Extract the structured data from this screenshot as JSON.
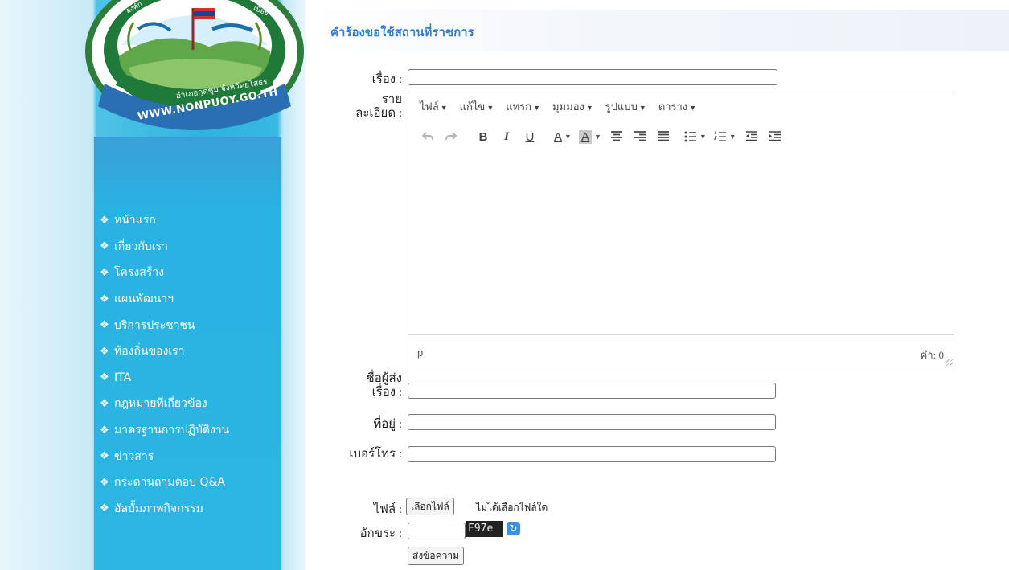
{
  "logo": {
    "url_text": "WWW.NONPUOY.GO.TH",
    "arc_left": "องค์ก",
    "arc_right": "เปือย",
    "district_text": "อำเภอกุดชุม จังหวัดยโสธร"
  },
  "nav": {
    "items": [
      {
        "label": "หน้าแรก"
      },
      {
        "label": "เกี่ยวกับเรา"
      },
      {
        "label": "โครงสร้าง"
      },
      {
        "label": "แผนพัฒนาฯ"
      },
      {
        "label": "บริการประชาชน"
      },
      {
        "label": "ท้องถิ่นของเรา"
      },
      {
        "label": "ITA"
      },
      {
        "label": "กฎหมายที่เกี่ยวข้อง"
      },
      {
        "label": "มาตรฐานการปฏิบัติงาน"
      },
      {
        "label": "ข่าวสาร"
      },
      {
        "label": "กระดานถามตอบ Q&A"
      },
      {
        "label": "อัลบั้มภาพกิจกรรม"
      }
    ]
  },
  "form": {
    "title": "คำร้องขอใช้สถานที่ราชการ",
    "subject_label": "เรื่อง :",
    "subject_value": "",
    "detail_label_line1": "ราย",
    "detail_label_line2": "ละเอียด :",
    "sender_label_line1": "ชื่อผู้ส่ง",
    "sender_label_line2": "เรื่อง :",
    "sender_value": "",
    "address_label": "ที่อยู่ :",
    "address_value": "",
    "phone_label": "เบอร์โทร :",
    "phone_value": "",
    "file_label": "ไฟล์ :",
    "file_button": "เลือกไฟล์",
    "file_status": "ไม่ได้เลือกไฟล์ใด",
    "captcha_label": "อักขระ :",
    "captcha_value": "",
    "captcha_text": "F97e",
    "submit_label": "ส่งข้อความ"
  },
  "editor": {
    "menus": [
      "ไฟล์",
      "แก้ไข",
      "แทรก",
      "มุมมอง",
      "รูปแบบ",
      "ตาราง"
    ],
    "toolbar": {
      "undo": "undo-icon",
      "redo": "redo-icon",
      "bold": "B",
      "italic": "I",
      "underline": "U",
      "text_color": "A",
      "bg_color": "A"
    },
    "status_path": "p",
    "word_count": "คำ: 0"
  },
  "colors": {
    "title": "#2a7bd1",
    "sidebar": "#2fb3df",
    "refresh_button": "#3f8fe0"
  }
}
